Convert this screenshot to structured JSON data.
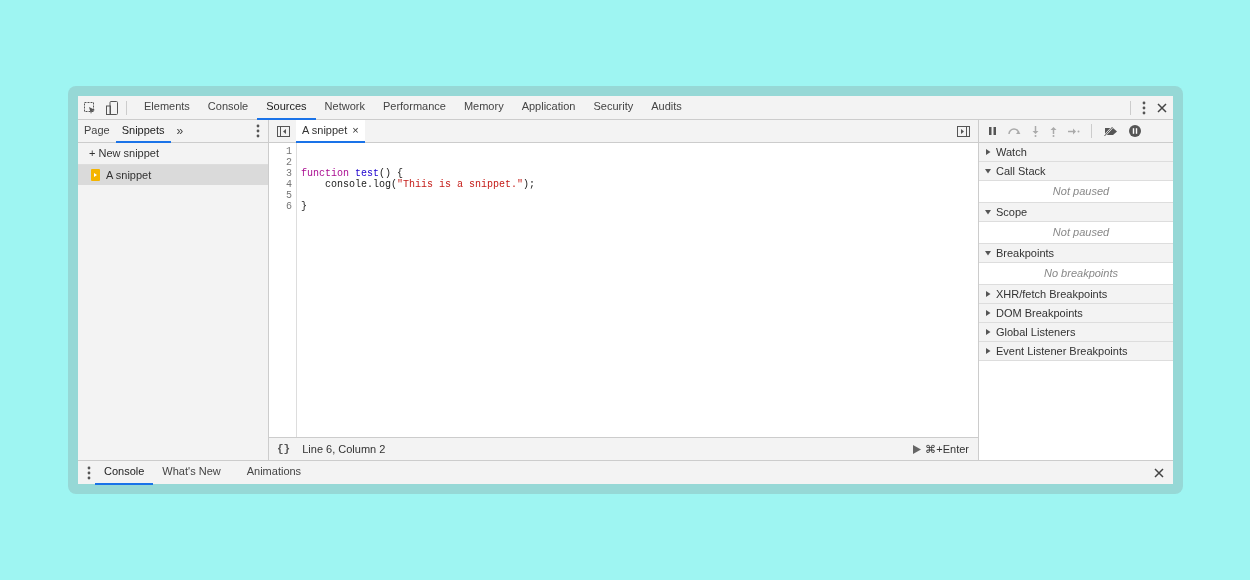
{
  "main_tabs": [
    {
      "label": "Elements",
      "selected": false
    },
    {
      "label": "Console",
      "selected": false
    },
    {
      "label": "Sources",
      "selected": true
    },
    {
      "label": "Network",
      "selected": false
    },
    {
      "label": "Performance",
      "selected": false
    },
    {
      "label": "Memory",
      "selected": false
    },
    {
      "label": "Application",
      "selected": false
    },
    {
      "label": "Security",
      "selected": false
    },
    {
      "label": "Audits",
      "selected": false
    }
  ],
  "navigator": {
    "tabs": [
      {
        "label": "Page",
        "selected": false
      },
      {
        "label": "Snippets",
        "selected": true
      }
    ],
    "more": "»",
    "new_snippet": "+ New snippet",
    "items": [
      {
        "label": "A snippet",
        "selected": true
      }
    ]
  },
  "editor": {
    "tabs": [
      {
        "label": "A snippet",
        "selected": true,
        "close": "×"
      }
    ],
    "lines": [
      {
        "number": "1"
      },
      {
        "number": "2"
      },
      {
        "number": "3",
        "tokens": [
          {
            "kind": "keyword",
            "text": "function"
          },
          {
            "kind": "name",
            "text": " test"
          },
          {
            "kind": "plain",
            "text": "() {"
          }
        ]
      },
      {
        "number": "4",
        "tokens": [
          {
            "kind": "plain",
            "text": "    console.log("
          },
          {
            "kind": "string",
            "text": "\"Thiis is a snippet.\""
          },
          {
            "kind": "plain",
            "text": ");"
          }
        ]
      },
      {
        "number": "5"
      },
      {
        "number": "6",
        "tokens": [
          {
            "kind": "plain",
            "text": "}"
          }
        ]
      }
    ],
    "status": {
      "format": "{}",
      "position": "Line 6, Column 2",
      "run": "⌘+Enter"
    }
  },
  "debugger": {
    "sections": [
      {
        "label": "Watch",
        "expanded": false
      },
      {
        "label": "Call Stack",
        "expanded": true,
        "body": "Not paused"
      },
      {
        "label": "Scope",
        "expanded": true,
        "body": "Not paused"
      },
      {
        "label": "Breakpoints",
        "expanded": true,
        "body": "No breakpoints"
      },
      {
        "label": "XHR/fetch Breakpoints",
        "expanded": false
      },
      {
        "label": "DOM Breakpoints",
        "expanded": false
      },
      {
        "label": "Global Listeners",
        "expanded": false
      },
      {
        "label": "Event Listener Breakpoints",
        "expanded": false
      }
    ]
  },
  "drawer": {
    "tabs": [
      {
        "label": "Console",
        "selected": true
      },
      {
        "label": "What's New",
        "selected": false
      },
      {
        "label": "Animations",
        "selected": false
      }
    ]
  }
}
